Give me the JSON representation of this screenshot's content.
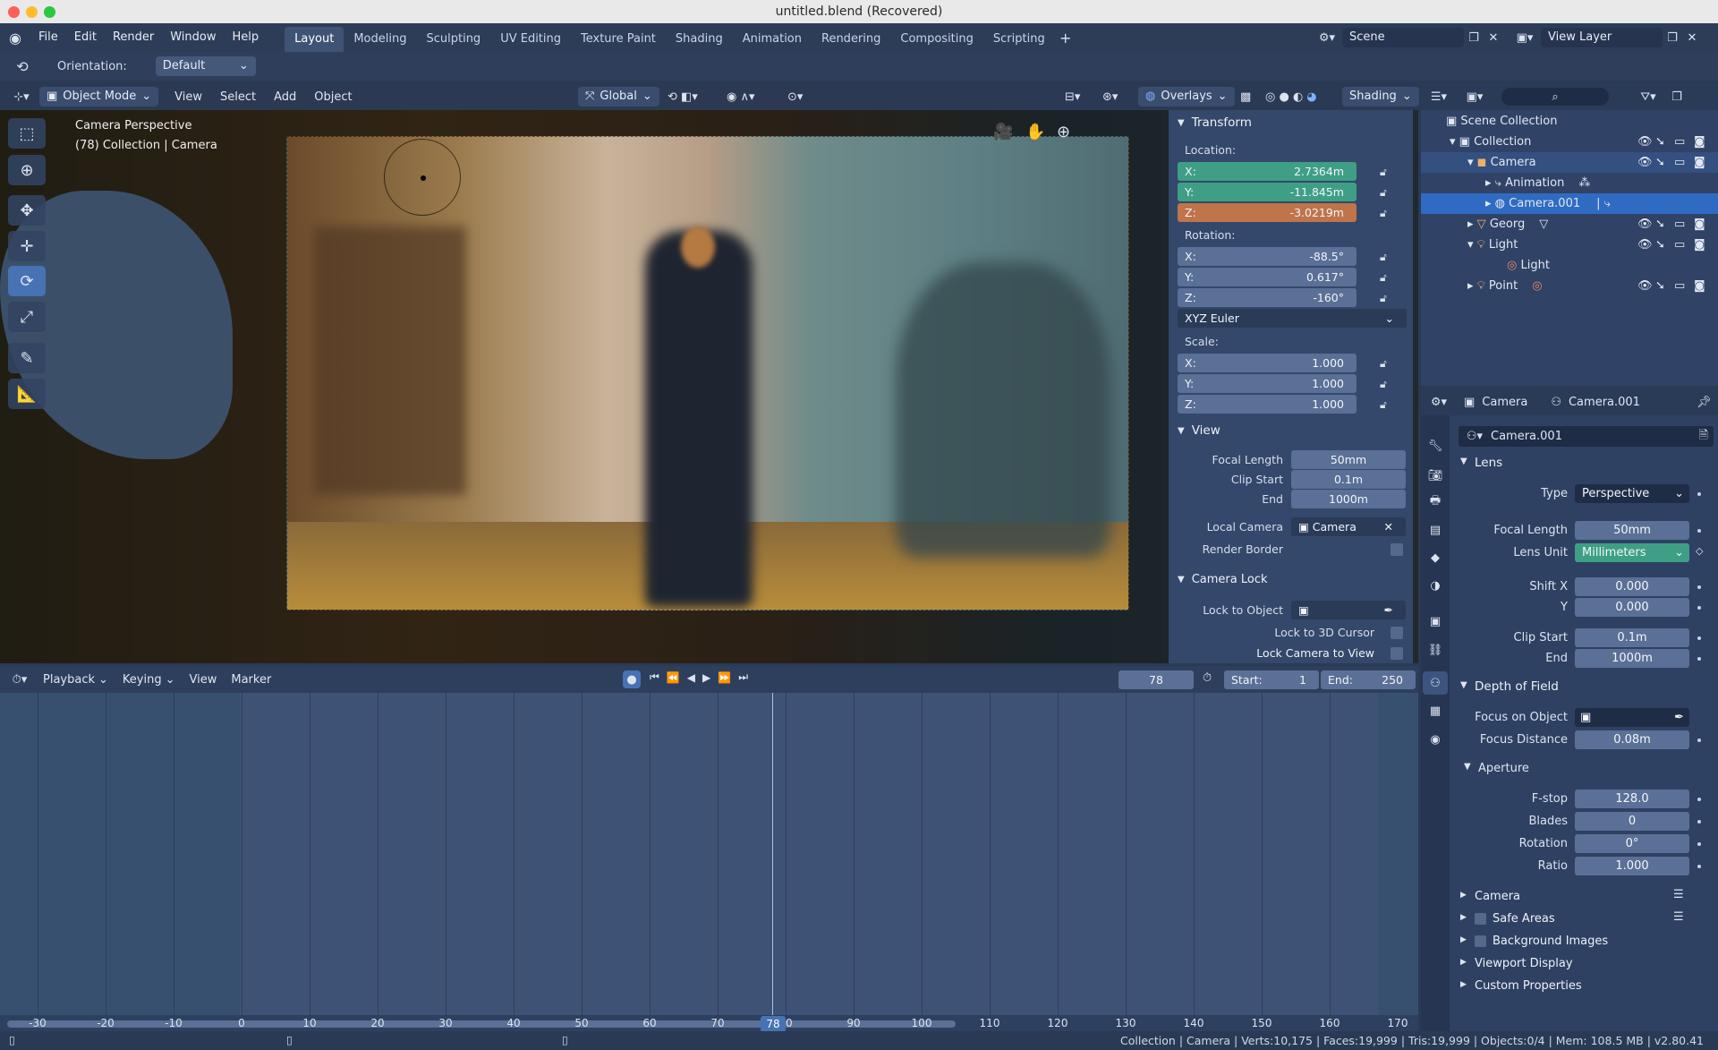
{
  "window": {
    "title": "untitled.blend (Recovered)"
  },
  "menu": [
    "File",
    "Edit",
    "Render",
    "Window",
    "Help"
  ],
  "workspaces": [
    {
      "label": "Layout",
      "active": true
    },
    {
      "label": "Modeling"
    },
    {
      "label": "Sculpting"
    },
    {
      "label": "UV Editing"
    },
    {
      "label": "Texture Paint"
    },
    {
      "label": "Shading"
    },
    {
      "label": "Animation"
    },
    {
      "label": "Rendering"
    },
    {
      "label": "Compositing"
    },
    {
      "label": "Scripting"
    }
  ],
  "scene": {
    "name": "Scene",
    "view_layer": "View Layer"
  },
  "tool_settings": {
    "orientation_label": "Orientation:",
    "orientation_value": "Default"
  },
  "viewport_header": {
    "mode": "Object Mode",
    "menus": [
      "View",
      "Select",
      "Add",
      "Object"
    ],
    "transform_orientation": "Global",
    "overlays": "Overlays",
    "shading": "Shading"
  },
  "viewport": {
    "camera_label": "Camera Perspective",
    "collection_label": "(78) Collection | Camera"
  },
  "npanel": {
    "transform_title": "Transform",
    "location_label": "Location:",
    "location": {
      "x": "2.7364m",
      "y": "-11.845m",
      "z": "-3.0219m"
    },
    "rotation_label": "Rotation:",
    "rotation": {
      "x": "-88.5°",
      "y": "0.617°",
      "z": "-160°"
    },
    "rotation_mode": "XYZ Euler",
    "scale_label": "Scale:",
    "scale": {
      "x": "1.000",
      "y": "1.000",
      "z": "1.000"
    },
    "axis": {
      "x": "X:",
      "y": "Y:",
      "z": "Z:"
    },
    "view_title": "View",
    "focal_length_label": "Focal Length",
    "focal_length": "50mm",
    "clip_start_label": "Clip Start",
    "clip_start": "0.1m",
    "clip_end_label": "End",
    "clip_end": "1000m",
    "local_camera_label": "Local Camera",
    "local_camera": "Camera",
    "render_border_label": "Render Border",
    "camera_lock_title": "Camera Lock",
    "lock_object_label": "Lock to Object",
    "lock_cursor_label": "Lock to 3D Cursor",
    "lock_camera_label": "Lock Camera to View"
  },
  "outliner": {
    "rows": [
      {
        "label": "Scene Collection",
        "indent": 0
      },
      {
        "label": "Collection",
        "indent": 1
      },
      {
        "label": "Camera",
        "indent": 2
      },
      {
        "label": "Animation",
        "indent": 3
      },
      {
        "label": "Camera.001",
        "indent": 3,
        "selected": true
      },
      {
        "label": "Georg",
        "indent": 2
      },
      {
        "label": "Light",
        "indent": 2
      },
      {
        "label": "Light",
        "indent": 3
      },
      {
        "label": "Point",
        "indent": 2
      }
    ]
  },
  "properties": {
    "object_name": "Camera",
    "data_name": "Camera.001",
    "datablock": "Camera.001",
    "lens_title": "Lens",
    "type_label": "Type",
    "type_value": "Perspective",
    "focal_length_label": "Focal Length",
    "focal_length": "50mm",
    "lens_unit_label": "Lens Unit",
    "lens_unit": "Millimeters",
    "shift_x_label": "Shift X",
    "shift_x": "0.000",
    "shift_y_label": "Y",
    "shift_y": "0.000",
    "clip_start_label": "Clip Start",
    "clip_start": "0.1m",
    "clip_end_label": "End",
    "clip_end": "1000m",
    "dof_title": "Depth of Field",
    "focus_object_label": "Focus on Object",
    "focus_distance_label": "Focus Distance",
    "focus_distance": "0.08m",
    "aperture_title": "Aperture",
    "fstop_label": "F-stop",
    "fstop": "128.0",
    "blades_label": "Blades",
    "blades": "0",
    "rotation_label": "Rotation",
    "rotation": "0°",
    "ratio_label": "Ratio",
    "ratio": "1.000",
    "collapsed": [
      "Camera",
      "Safe Areas",
      "Background Images",
      "Viewport Display",
      "Custom Properties"
    ]
  },
  "timeline": {
    "menus": [
      "Playback",
      "Keying",
      "View",
      "Marker"
    ],
    "current_frame": "78",
    "start_label": "Start:",
    "start": "1",
    "end_label": "End:",
    "end": "250",
    "ruler": [
      "-30",
      "-20",
      "-10",
      "0",
      "10",
      "20",
      "30",
      "40",
      "50",
      "60",
      "70",
      "80",
      "90",
      "100",
      "110",
      "120",
      "130",
      "140",
      "150",
      "160",
      "170"
    ]
  },
  "statusbar": {
    "text": "Collection | Camera | Verts:10,175 | Faces:19,999 | Tris:19,999 | Objects:0/4 | Mem: 108.5 MB | v2.80.41"
  },
  "colors": {
    "accent_blue": "#4772b3",
    "x_field": "#3e9f86",
    "z_field": "#c0744a",
    "selected_row": "#2f6bc2",
    "header": "#2d3d58"
  }
}
